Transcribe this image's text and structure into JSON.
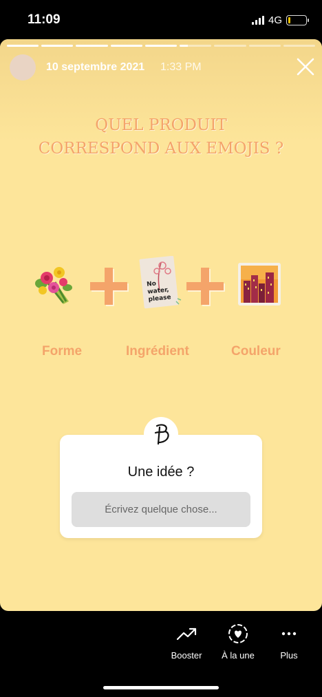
{
  "status_bar": {
    "time": "11:09",
    "network": "4G",
    "battery_level": 0.12
  },
  "story": {
    "progress_segments": [
      1,
      1,
      1,
      1,
      1,
      0.25,
      0,
      0,
      0
    ],
    "date": "10 septembre 2021",
    "time": "1:33 PM",
    "question_line1": "QUEL PRODUIT",
    "question_line2": "CORRESPOND AUX EMOJIS ?",
    "emojis": [
      "bouquet-icon",
      "plus-icon",
      "no-water-sticker-icon",
      "plus-icon",
      "city-sunset-icon"
    ],
    "sticker_text": "No water, please",
    "labels": {
      "forme": "Forme",
      "ingredient": "Ingrédient",
      "couleur": "Couleur"
    },
    "question_sticker": {
      "title": "Une idée ?",
      "placeholder": "Écrivez quelque chose..."
    },
    "colors": {
      "background": "#fde59a",
      "accent": "#f4a46a"
    }
  },
  "actions": {
    "booster": "Booster",
    "a_la_une": "À la une",
    "plus": "Plus"
  }
}
